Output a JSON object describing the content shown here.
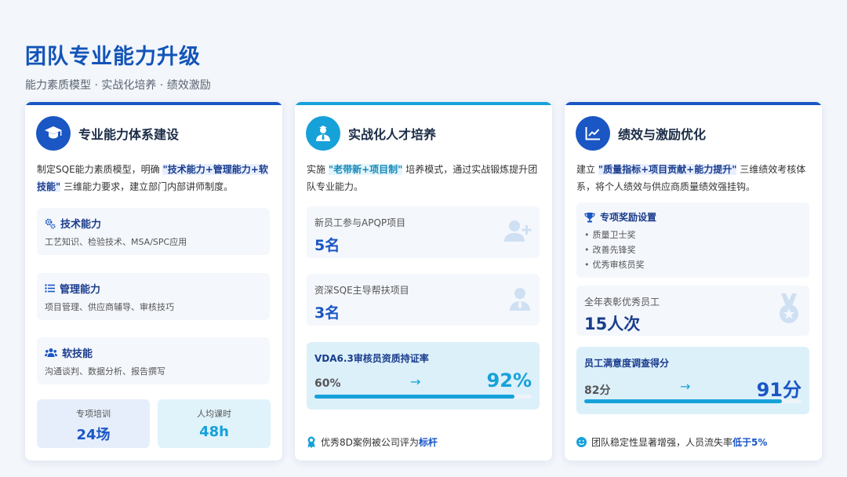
{
  "header": {
    "title": "团队专业能力升级",
    "subtitle": "能力素质模型 · 实战化培养 · 绩效激励"
  },
  "colors": {
    "primary": "#1a56c4",
    "accent": "#16a1d9",
    "title": "#1254b8"
  },
  "card1": {
    "icon": "graduation-cap-icon",
    "title": "专业能力体系建设",
    "intro_pre": "制定SQE能力素质模型，明确 ",
    "intro_hl": "\"技术能力+管理能力+软技能\"",
    "intro_post": " 三维能力要求，建立部门内部讲师制度。",
    "skills": [
      {
        "icon": "gears-icon",
        "name": "技术能力",
        "desc": "工艺知识、检验技术、MSA/SPC应用"
      },
      {
        "icon": "list-icon",
        "name": "管理能力",
        "desc": "项目管理、供应商辅导、审核技巧"
      },
      {
        "icon": "users-icon",
        "name": "软技能",
        "desc": "沟通谈判、数据分析、报告撰写"
      }
    ],
    "stats": [
      {
        "label": "专项培训",
        "value": "24场"
      },
      {
        "label": "人均课时",
        "value": "48h"
      }
    ]
  },
  "card2": {
    "icon": "user-tie-icon",
    "title": "实战化人才培养",
    "intro_pre": "实施 ",
    "intro_hl": "\"老带新+项目制\"",
    "intro_post": " 培养模式，通过实战锻炼提升团队专业能力。",
    "items": [
      {
        "label": "新员工参与APQP项目",
        "value": "5名",
        "icon": "user-plus-icon"
      },
      {
        "label": "资深SQE主导帮扶项目",
        "value": "3名",
        "icon": "user-tie-icon"
      }
    ],
    "progress": {
      "title": "VDA6.3审核员资质持证率",
      "from": "60%",
      "arrow": "→",
      "to": "92%",
      "fraction": 0.92
    },
    "footer_pre": "优秀8D案例被公司评为",
    "footer_hl": "标杆"
  },
  "card3": {
    "icon": "chart-line-icon",
    "title": "绩效与激励优化",
    "intro_pre": "建立 ",
    "intro_hl": "\"质量指标+项目贡献+能力提升\"",
    "intro_post": " 三维绩效考核体系，将个人绩效与供应商质量绩效强挂钩。",
    "award": {
      "title": "专项奖励设置",
      "items": [
        "质量卫士奖",
        "改善先锋奖",
        "优秀审核员奖"
      ]
    },
    "stat": {
      "label": "全年表彰优秀员工",
      "value": "15人次"
    },
    "progress": {
      "title": "员工满意度调查得分",
      "from": "82分",
      "arrow": "→",
      "to": "91分",
      "fraction": 0.91
    },
    "footer_pre": "团队稳定性显著增强，人员流失率",
    "footer_hl": "低于5%"
  }
}
